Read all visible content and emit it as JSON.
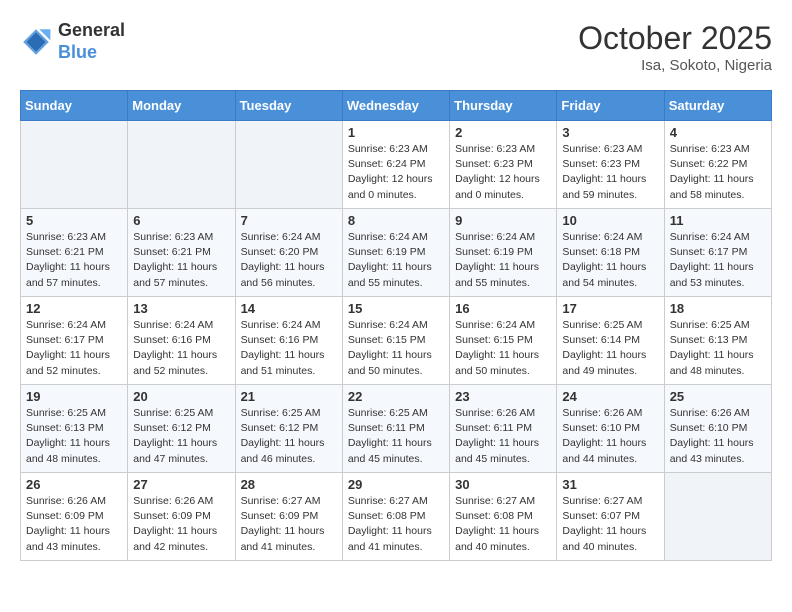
{
  "header": {
    "logo_general": "General",
    "logo_blue": "Blue",
    "month_title": "October 2025",
    "subtitle": "Isa, Sokoto, Nigeria"
  },
  "weekdays": [
    "Sunday",
    "Monday",
    "Tuesday",
    "Wednesday",
    "Thursday",
    "Friday",
    "Saturday"
  ],
  "weeks": [
    [
      {
        "day": "",
        "detail": ""
      },
      {
        "day": "",
        "detail": ""
      },
      {
        "day": "",
        "detail": ""
      },
      {
        "day": "1",
        "detail": "Sunrise: 6:23 AM\nSunset: 6:24 PM\nDaylight: 12 hours\nand 0 minutes."
      },
      {
        "day": "2",
        "detail": "Sunrise: 6:23 AM\nSunset: 6:23 PM\nDaylight: 12 hours\nand 0 minutes."
      },
      {
        "day": "3",
        "detail": "Sunrise: 6:23 AM\nSunset: 6:23 PM\nDaylight: 11 hours\nand 59 minutes."
      },
      {
        "day": "4",
        "detail": "Sunrise: 6:23 AM\nSunset: 6:22 PM\nDaylight: 11 hours\nand 58 minutes."
      }
    ],
    [
      {
        "day": "5",
        "detail": "Sunrise: 6:23 AM\nSunset: 6:21 PM\nDaylight: 11 hours\nand 57 minutes."
      },
      {
        "day": "6",
        "detail": "Sunrise: 6:23 AM\nSunset: 6:21 PM\nDaylight: 11 hours\nand 57 minutes."
      },
      {
        "day": "7",
        "detail": "Sunrise: 6:24 AM\nSunset: 6:20 PM\nDaylight: 11 hours\nand 56 minutes."
      },
      {
        "day": "8",
        "detail": "Sunrise: 6:24 AM\nSunset: 6:19 PM\nDaylight: 11 hours\nand 55 minutes."
      },
      {
        "day": "9",
        "detail": "Sunrise: 6:24 AM\nSunset: 6:19 PM\nDaylight: 11 hours\nand 55 minutes."
      },
      {
        "day": "10",
        "detail": "Sunrise: 6:24 AM\nSunset: 6:18 PM\nDaylight: 11 hours\nand 54 minutes."
      },
      {
        "day": "11",
        "detail": "Sunrise: 6:24 AM\nSunset: 6:17 PM\nDaylight: 11 hours\nand 53 minutes."
      }
    ],
    [
      {
        "day": "12",
        "detail": "Sunrise: 6:24 AM\nSunset: 6:17 PM\nDaylight: 11 hours\nand 52 minutes."
      },
      {
        "day": "13",
        "detail": "Sunrise: 6:24 AM\nSunset: 6:16 PM\nDaylight: 11 hours\nand 52 minutes."
      },
      {
        "day": "14",
        "detail": "Sunrise: 6:24 AM\nSunset: 6:16 PM\nDaylight: 11 hours\nand 51 minutes."
      },
      {
        "day": "15",
        "detail": "Sunrise: 6:24 AM\nSunset: 6:15 PM\nDaylight: 11 hours\nand 50 minutes."
      },
      {
        "day": "16",
        "detail": "Sunrise: 6:24 AM\nSunset: 6:15 PM\nDaylight: 11 hours\nand 50 minutes."
      },
      {
        "day": "17",
        "detail": "Sunrise: 6:25 AM\nSunset: 6:14 PM\nDaylight: 11 hours\nand 49 minutes."
      },
      {
        "day": "18",
        "detail": "Sunrise: 6:25 AM\nSunset: 6:13 PM\nDaylight: 11 hours\nand 48 minutes."
      }
    ],
    [
      {
        "day": "19",
        "detail": "Sunrise: 6:25 AM\nSunset: 6:13 PM\nDaylight: 11 hours\nand 48 minutes."
      },
      {
        "day": "20",
        "detail": "Sunrise: 6:25 AM\nSunset: 6:12 PM\nDaylight: 11 hours\nand 47 minutes."
      },
      {
        "day": "21",
        "detail": "Sunrise: 6:25 AM\nSunset: 6:12 PM\nDaylight: 11 hours\nand 46 minutes."
      },
      {
        "day": "22",
        "detail": "Sunrise: 6:25 AM\nSunset: 6:11 PM\nDaylight: 11 hours\nand 45 minutes."
      },
      {
        "day": "23",
        "detail": "Sunrise: 6:26 AM\nSunset: 6:11 PM\nDaylight: 11 hours\nand 45 minutes."
      },
      {
        "day": "24",
        "detail": "Sunrise: 6:26 AM\nSunset: 6:10 PM\nDaylight: 11 hours\nand 44 minutes."
      },
      {
        "day": "25",
        "detail": "Sunrise: 6:26 AM\nSunset: 6:10 PM\nDaylight: 11 hours\nand 43 minutes."
      }
    ],
    [
      {
        "day": "26",
        "detail": "Sunrise: 6:26 AM\nSunset: 6:09 PM\nDaylight: 11 hours\nand 43 minutes."
      },
      {
        "day": "27",
        "detail": "Sunrise: 6:26 AM\nSunset: 6:09 PM\nDaylight: 11 hours\nand 42 minutes."
      },
      {
        "day": "28",
        "detail": "Sunrise: 6:27 AM\nSunset: 6:09 PM\nDaylight: 11 hours\nand 41 minutes."
      },
      {
        "day": "29",
        "detail": "Sunrise: 6:27 AM\nSunset: 6:08 PM\nDaylight: 11 hours\nand 41 minutes."
      },
      {
        "day": "30",
        "detail": "Sunrise: 6:27 AM\nSunset: 6:08 PM\nDaylight: 11 hours\nand 40 minutes."
      },
      {
        "day": "31",
        "detail": "Sunrise: 6:27 AM\nSunset: 6:07 PM\nDaylight: 11 hours\nand 40 minutes."
      },
      {
        "day": "",
        "detail": ""
      }
    ]
  ]
}
